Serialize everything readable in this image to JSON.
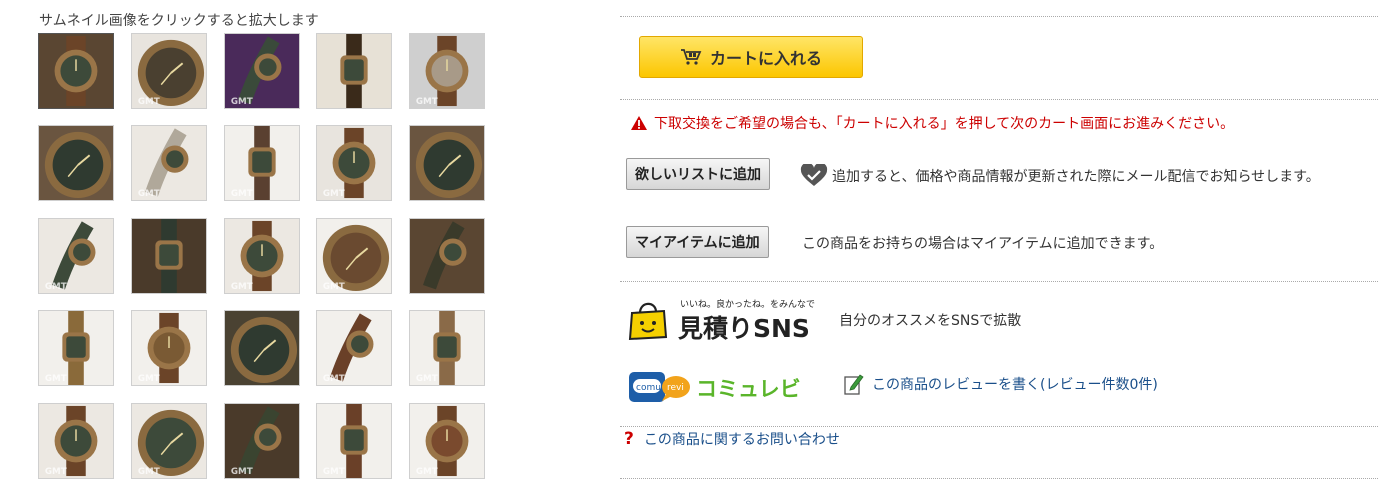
{
  "gallery": {
    "caption": "サムネイル画像をクリックすると拡大します",
    "thumbnails": [
      {
        "alt": "watch front bronze",
        "tone": "#5a4632",
        "face": "#3d4a3a",
        "watermark": ""
      },
      {
        "alt": "watch side",
        "tone": "#e8e4de",
        "face": "#4a4030",
        "watermark": "GMT"
      },
      {
        "alt": "watch purple background",
        "tone": "#4a2a5a",
        "face": "#3a4a3a",
        "watermark": "GMT"
      },
      {
        "alt": "watch box",
        "tone": "#e7e1d6",
        "face": "#3a2a1a",
        "watermark": ""
      },
      {
        "alt": "watch caseback",
        "tone": "#cfcfcf",
        "face": "#a89a88",
        "watermark": "GMT"
      },
      {
        "alt": "watch crown closeup",
        "tone": "#6a5540",
        "face": "#2f3a30",
        "watermark": ""
      },
      {
        "alt": "watch back strap",
        "tone": "#ece8e2",
        "face": "#b0a89a",
        "watermark": "GMT"
      },
      {
        "alt": "watch full strap",
        "tone": "#f2f0ec",
        "face": "#5a4030",
        "watermark": "GMT"
      },
      {
        "alt": "watch angle",
        "tone": "#e8e4de",
        "face": "#3d4a3a",
        "watermark": "GMT"
      },
      {
        "alt": "watch dial closeup",
        "tone": "#6a5540",
        "face": "#2f3a30",
        "watermark": ""
      },
      {
        "alt": "watch with strap",
        "tone": "#ece8e2",
        "face": "#3d4a3a",
        "watermark": "GMT"
      },
      {
        "alt": "dial detail",
        "tone": "#4a3a2a",
        "face": "#2f3a30",
        "watermark": ""
      },
      {
        "alt": "watch top",
        "tone": "#ece8e2",
        "face": "#3d4a3a",
        "watermark": "GMT"
      },
      {
        "alt": "watch side strap",
        "tone": "#f2f0ec",
        "face": "#6a4a30",
        "watermark": "GMT"
      },
      {
        "alt": "bezel closeup",
        "tone": "#5a4632",
        "face": "#3a3a2a",
        "watermark": ""
      },
      {
        "alt": "case profile",
        "tone": "#f2f0ec",
        "face": "#8a6a3a",
        "watermark": "GMT"
      },
      {
        "alt": "case profile back",
        "tone": "#f2f0ec",
        "face": "#7a5a34",
        "watermark": "GMT"
      },
      {
        "alt": "dial macro",
        "tone": "#4a4232",
        "face": "#2f3a30",
        "watermark": ""
      },
      {
        "alt": "strap buckle",
        "tone": "#f2f0ec",
        "face": "#6a4028",
        "watermark": "GMT"
      },
      {
        "alt": "strap stitching",
        "tone": "#f2f0ec",
        "face": "#8a6a48",
        "watermark": "GMT"
      },
      {
        "alt": "watch on strap",
        "tone": "#ece8e2",
        "face": "#3d4a3a",
        "watermark": "GMT"
      },
      {
        "alt": "watch tilted",
        "tone": "#ece8e2",
        "face": "#3d4a3a",
        "watermark": "GMT"
      },
      {
        "alt": "crown guard macro",
        "tone": "#4a3a2a",
        "face": "#3a4430",
        "watermark": "GMT"
      },
      {
        "alt": "strap end",
        "tone": "#f2f0ec",
        "face": "#6a4028",
        "watermark": "GMT"
      },
      {
        "alt": "strap tail",
        "tone": "#f2f0ec",
        "face": "#7a4a2e",
        "watermark": "GMT"
      }
    ]
  },
  "actions": {
    "cart_label": "カートに入れる",
    "trade_notice": "下取交換をご希望の場合も、「カートに入れる」を押して次のカート画面にお進みください。",
    "wishlist_label": "欲しいリストに追加",
    "wishlist_desc": "追加すると、価格や商品情報が更新された際にメール配信でお知らせします。",
    "myitem_label": "マイアイテムに追加",
    "myitem_desc": "この商品をお持ちの場合はマイアイテムに追加できます。"
  },
  "sns": {
    "logo_tagline": "いいね。良かったね。をみんなで",
    "logo_text": "見積りSNS",
    "desc": "自分のオススメをSNSで拡散"
  },
  "comurevi": {
    "logo_tag_left": "comu",
    "logo_tag_right": "revi",
    "logo_text": "コミュレビ",
    "write_review_link": "この商品のレビューを書く(レビュー件数0件)"
  },
  "inquiry": {
    "link": "この商品に関するお問い合わせ"
  },
  "colors": {
    "warning_red": "#cc0000",
    "link_blue": "#1a4f8a",
    "cart_yellow": "#fcc600",
    "heart_gray": "#555555",
    "sns_yellow": "#f5d000",
    "comurevi_blue": "#1e5ea8",
    "comurevi_green": "#5ab52a"
  }
}
